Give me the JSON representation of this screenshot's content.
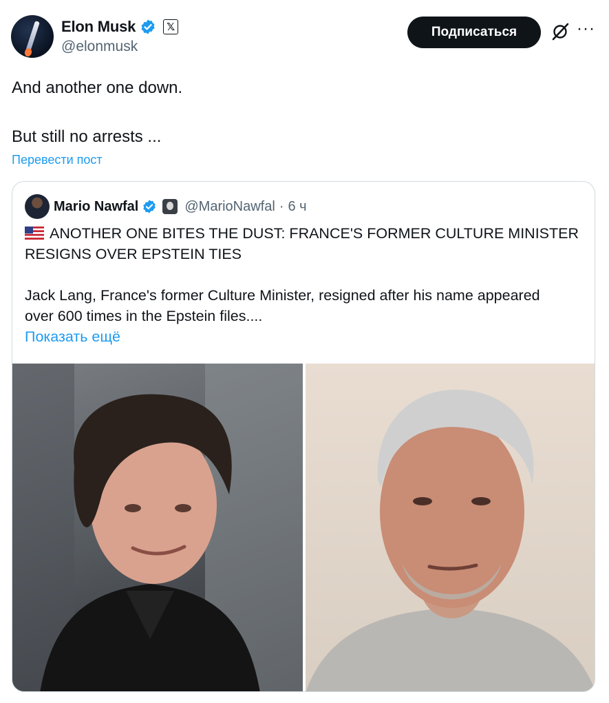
{
  "author": {
    "display_name": "Elon Musk",
    "handle": "@elonmusk",
    "avatar_icon": "rocket-avatar",
    "verified_icon": "verified-badge-icon",
    "affiliate_icon": "x-logo-icon",
    "affiliate_glyph": "𝕏"
  },
  "actions": {
    "follow_label": "Подписаться",
    "grok_icon": "grok-icon",
    "more_icon": "more-icon",
    "more_glyph": "···"
  },
  "tweet": {
    "lines": [
      "And another one down.",
      "But still no arrests ..."
    ],
    "translate_label": "Перевести пост"
  },
  "quote": {
    "display_name": "Mario Nawfal",
    "handle": "@MarioNawfal",
    "separator": "·",
    "time": "6 ч",
    "headline_lines": [
      "ANOTHER ONE BITES THE DUST: FRANCE'S FORMER CULTURE MINISTER",
      "RESIGNS OVER EPSTEIN TIES"
    ],
    "flag_icon": "us-flag-icon",
    "body_lines": [
      "Jack Lang, France's former Culture Minister, resigned after his name appeared",
      "over 600 times in the Epstein files...."
    ],
    "show_more_label": "Показать ещё",
    "images": [
      "portrait-photo-left",
      "portrait-photo-right"
    ]
  },
  "colors": {
    "text": "#0f1419",
    "secondary": "#536471",
    "link": "#1d9bf0",
    "border": "#cfd9de",
    "verified": "#1d9bf0",
    "button_bg": "#0f1419"
  }
}
